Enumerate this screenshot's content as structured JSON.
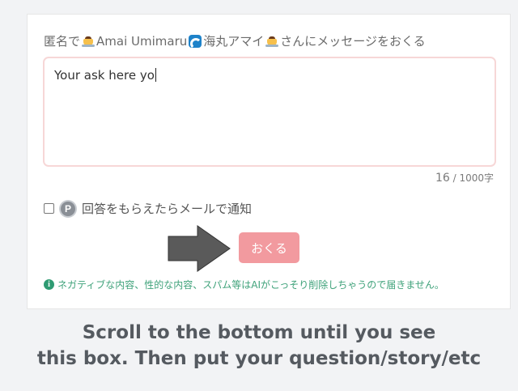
{
  "form": {
    "label_prefix": "匿名で",
    "label_name": "Amai Umimaru",
    "label_name_jp": "海丸アマイ",
    "label_suffix": "さんにメッセージをおくる",
    "textarea_value": "Your ask here yo",
    "counter_current": "16",
    "counter_max": " / 1000字",
    "notify_label": "回答をもらえたらメールで通知",
    "notify_badge": "P",
    "send_label": "おくる",
    "info_icon_text": "i",
    "info_text": "ネガティブな内容、性的な内容、スパム等はAIがこっそり削除しちゃうので届きません。"
  },
  "caption": {
    "line1": "Scroll to the bottom until you see",
    "line2": "this box. Then put your question/story/etc"
  },
  "icons": {
    "pudding": "pudding-icon",
    "wave": "wave-icon",
    "arrow": "arrow-right-icon"
  },
  "colors": {
    "send_button": "#f29a9f",
    "textarea_border": "#f7d7d7",
    "info_text": "#3fa27a",
    "caption_text": "#555a60"
  }
}
